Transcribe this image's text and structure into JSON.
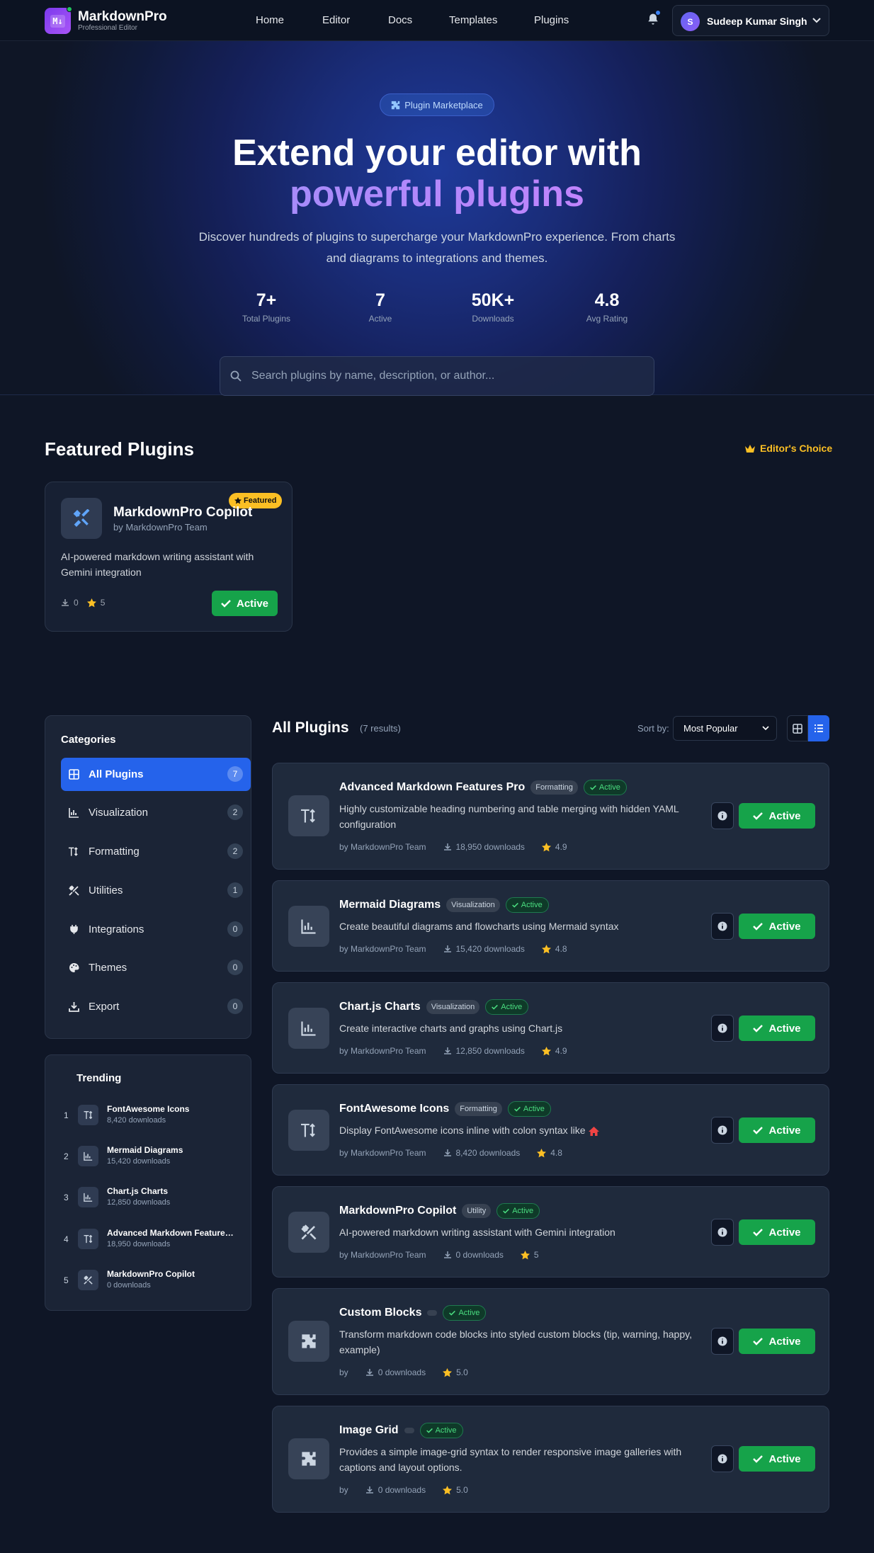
{
  "nav": {
    "brand": "MarkdownPro",
    "brand_sub": "Professional Editor",
    "logo_glyph": "M↓",
    "links": [
      "Home",
      "Editor",
      "Docs",
      "Templates",
      "Plugins"
    ],
    "user_initial": "S",
    "user_name": "Sudeep Kumar Singh"
  },
  "hero": {
    "pill": "Plugin Marketplace",
    "title_line1": "Extend your editor with",
    "title_line2": "powerful plugins",
    "description": "Discover hundreds of plugins to supercharge your MarkdownPro experience. From charts and diagrams to integrations and themes.",
    "stats": [
      {
        "value": "7+",
        "label": "Total Plugins"
      },
      {
        "value": "7",
        "label": "Active"
      },
      {
        "value": "50K+",
        "label": "Downloads"
      },
      {
        "value": "4.8",
        "label": "Avg Rating"
      }
    ],
    "search_placeholder": "Search plugins by name, description, or author..."
  },
  "featured": {
    "title": "Featured Plugins",
    "editors_choice": "Editor's Choice",
    "card": {
      "badge": "Featured",
      "name": "MarkdownPro Copilot",
      "by": "by MarkdownPro Team",
      "description": "AI-powered markdown writing assistant with Gemini integration",
      "downloads": "0",
      "rating": "5",
      "button": "Active"
    }
  },
  "categories": {
    "title": "Categories",
    "items": [
      {
        "label": "All Plugins",
        "count": "7",
        "icon": "grid-icon"
      },
      {
        "label": "Visualization",
        "count": "2",
        "icon": "chart-icon"
      },
      {
        "label": "Formatting",
        "count": "2",
        "icon": "text-height-icon"
      },
      {
        "label": "Utilities",
        "count": "1",
        "icon": "tools-icon"
      },
      {
        "label": "Integrations",
        "count": "0",
        "icon": "plug-icon"
      },
      {
        "label": "Themes",
        "count": "0",
        "icon": "palette-icon"
      },
      {
        "label": "Export",
        "count": "0",
        "icon": "download-icon"
      }
    ]
  },
  "trending": {
    "title": "Trending",
    "items": [
      {
        "rank": "1",
        "name": "FontAwesome Icons",
        "downloads": "8,420 downloads"
      },
      {
        "rank": "2",
        "name": "Mermaid Diagrams",
        "downloads": "15,420 downloads"
      },
      {
        "rank": "3",
        "name": "Chart.js Charts",
        "downloads": "12,850 downloads"
      },
      {
        "rank": "4",
        "name": "Advanced Markdown Features Pro",
        "downloads": "18,950 downloads"
      },
      {
        "rank": "5",
        "name": "MarkdownPro Copilot",
        "downloads": "0 downloads"
      }
    ]
  },
  "all_plugins": {
    "title": "All Plugins",
    "results": "(7 results)",
    "sort_label": "Sort by:",
    "sort_value": "Most Popular",
    "active_tag": "Active",
    "button": "Active",
    "plugins": [
      {
        "name": "Advanced Markdown Features Pro",
        "category": "Formatting",
        "description": "Highly customizable heading numbering and table merging with hidden YAML configuration",
        "by": "by MarkdownPro Team",
        "downloads": "18,950 downloads",
        "rating": "4.9"
      },
      {
        "name": "Mermaid Diagrams",
        "category": "Visualization",
        "description": "Create beautiful diagrams and flowcharts using Mermaid syntax",
        "by": "by MarkdownPro Team",
        "downloads": "15,420 downloads",
        "rating": "4.8"
      },
      {
        "name": "Chart.js Charts",
        "category": "Visualization",
        "description": "Create interactive charts and graphs using Chart.js",
        "by": "by MarkdownPro Team",
        "downloads": "12,850 downloads",
        "rating": "4.9"
      },
      {
        "name": "FontAwesome Icons",
        "category": "Formatting",
        "description": "Display FontAwesome icons inline with colon syntax like",
        "by": "by MarkdownPro Team",
        "downloads": "8,420 downloads",
        "rating": "4.8"
      },
      {
        "name": "MarkdownPro Copilot",
        "category": "Utility",
        "description": "AI-powered markdown writing assistant with Gemini integration",
        "by": "by MarkdownPro Team",
        "downloads": "0 downloads",
        "rating": "5"
      },
      {
        "name": "Custom Blocks",
        "category": "",
        "description": "Transform markdown code blocks into styled custom blocks (tip, warning, happy, example)",
        "by": "by",
        "downloads": "0 downloads",
        "rating": "5.0"
      },
      {
        "name": "Image Grid",
        "category": "",
        "description": "Provides a simple image-grid syntax to render responsive image galleries with captions and layout options.",
        "by": "by",
        "downloads": "0 downloads",
        "rating": "5.0"
      }
    ]
  },
  "colors": {
    "accent": "#2563eb",
    "active_green": "#16a34a",
    "star": "#fbbf24",
    "heading_purple": "#c084fc"
  }
}
